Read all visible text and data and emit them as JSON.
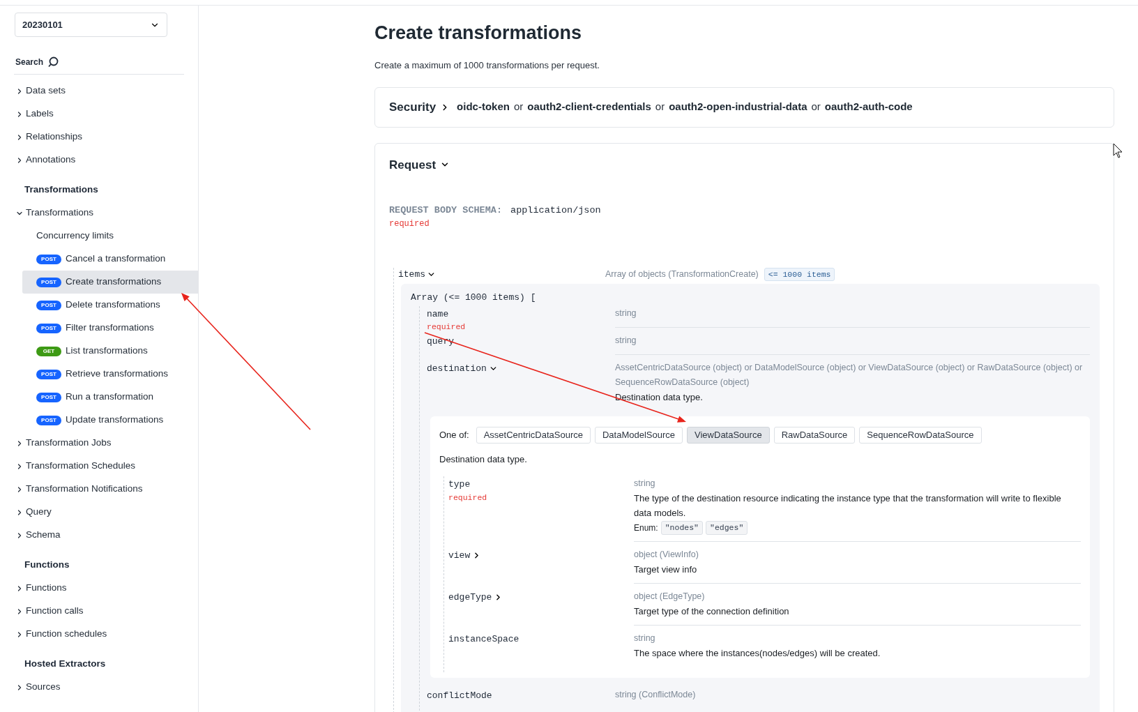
{
  "version_select": {
    "value": "20230101"
  },
  "search": {
    "label": "Search"
  },
  "sidebar": {
    "items": [
      {
        "kind": "group",
        "label": "Data sets",
        "expanded": false
      },
      {
        "kind": "group",
        "label": "Labels",
        "expanded": false
      },
      {
        "kind": "group",
        "label": "Relationships",
        "expanded": false
      },
      {
        "kind": "group",
        "label": "Annotations",
        "expanded": false
      },
      {
        "kind": "heading",
        "label": "Transformations"
      },
      {
        "kind": "group",
        "label": "Transformations",
        "expanded": true,
        "children": [
          {
            "kind": "link",
            "label": "Concurrency limits",
            "selected": false
          },
          {
            "kind": "endpoint",
            "method": "POST",
            "label": "Cancel a transformation",
            "selected": false
          },
          {
            "kind": "endpoint",
            "method": "POST",
            "label": "Create transformations",
            "selected": true
          },
          {
            "kind": "endpoint",
            "method": "POST",
            "label": "Delete transformations",
            "selected": false
          },
          {
            "kind": "endpoint",
            "method": "POST",
            "label": "Filter transformations",
            "selected": false
          },
          {
            "kind": "endpoint",
            "method": "GET",
            "label": "List transformations",
            "selected": false
          },
          {
            "kind": "endpoint",
            "method": "POST",
            "label": "Retrieve transformations",
            "selected": false
          },
          {
            "kind": "endpoint",
            "method": "POST",
            "label": "Run a transformation",
            "selected": false
          },
          {
            "kind": "endpoint",
            "method": "POST",
            "label": "Update transformations",
            "selected": false
          }
        ]
      },
      {
        "kind": "group",
        "label": "Transformation Jobs",
        "expanded": false
      },
      {
        "kind": "group",
        "label": "Transformation Schedules",
        "expanded": false
      },
      {
        "kind": "group",
        "label": "Transformation Notifications",
        "expanded": false
      },
      {
        "kind": "group",
        "label": "Query",
        "expanded": false
      },
      {
        "kind": "group",
        "label": "Schema",
        "expanded": false
      },
      {
        "kind": "heading",
        "label": "Functions"
      },
      {
        "kind": "group",
        "label": "Functions",
        "expanded": false
      },
      {
        "kind": "group",
        "label": "Function calls",
        "expanded": false
      },
      {
        "kind": "group",
        "label": "Function schedules",
        "expanded": false
      },
      {
        "kind": "heading",
        "label": "Hosted Extractors"
      },
      {
        "kind": "group",
        "label": "Sources",
        "expanded": false
      }
    ]
  },
  "page": {
    "title": "Create transformations",
    "subtitle": "Create a maximum of 1000 transformations per request."
  },
  "security": {
    "label": "Security",
    "parts": [
      {
        "kind": "scheme",
        "text": "oidc-token"
      },
      {
        "kind": "joiner",
        "text": "or"
      },
      {
        "kind": "scheme",
        "text": "oauth2-client-credentials"
      },
      {
        "kind": "joiner",
        "text": "or"
      },
      {
        "kind": "scheme",
        "text": "oauth2-open-industrial-data"
      },
      {
        "kind": "joiner",
        "text": "or"
      },
      {
        "kind": "scheme",
        "text": "oauth2-auth-code"
      }
    ]
  },
  "request": {
    "title": "Request",
    "expanded": true,
    "schema_label": "REQUEST BODY SCHEMA:",
    "content_type": "application/json",
    "required": "required",
    "items": {
      "name": "items",
      "expanded": true,
      "type": "Array of objects (TransformationCreate)",
      "constraint": "<= 1000 items",
      "array_open": "Array (<= 1000 items) [",
      "fields": [
        {
          "name": "name",
          "required": "required",
          "type": "string"
        },
        {
          "name": "query",
          "type": "string"
        },
        {
          "name": "destination",
          "expanded": true,
          "type": "AssetCentricDataSource (object) or DataModelSource (object) or ViewDataSource (object) or RawDataSource (object) or SequenceRowDataSource (object)",
          "description": "Destination data type.",
          "one_of": {
            "label": "One of:",
            "options": [
              {
                "label": "AssetCentricDataSource",
                "selected": false
              },
              {
                "label": "DataModelSource",
                "selected": false
              },
              {
                "label": "ViewDataSource",
                "selected": true
              },
              {
                "label": "RawDataSource",
                "selected": false
              },
              {
                "label": "SequenceRowDataSource",
                "selected": false
              }
            ],
            "description": "Destination data type.",
            "fields": [
              {
                "name": "type",
                "required": "required",
                "type": "string",
                "description": "The type of the destination resource indicating the instance type that the transformation will write to flexible data models.",
                "enum": {
                  "label": "Enum:",
                  "values": [
                    "\"nodes\"",
                    "\"edges\""
                  ]
                }
              },
              {
                "name": "view",
                "expanded": false,
                "type": "object (ViewInfo)",
                "description": "Target view info"
              },
              {
                "name": "edgeType",
                "expanded": false,
                "type": "object (EdgeType)",
                "description": "Target type of the connection definition"
              },
              {
                "name": "instanceSpace",
                "type": "string",
                "description": "The space where the instances(nodes/edges) will be created."
              }
            ]
          }
        },
        {
          "name": "conflictMode",
          "type": "string (ConflictMode)"
        }
      ]
    }
  }
}
